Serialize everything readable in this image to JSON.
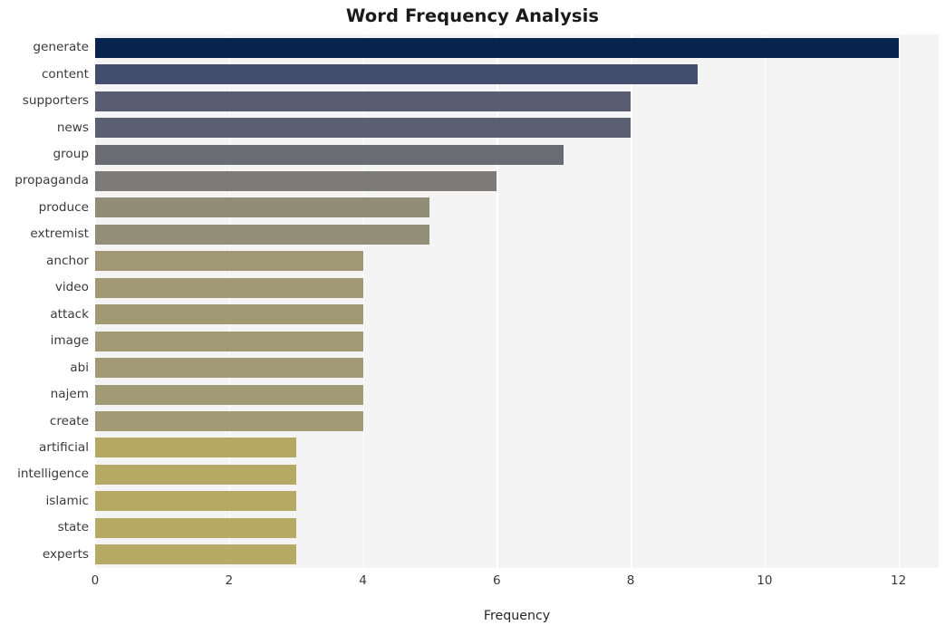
{
  "chart_data": {
    "type": "bar",
    "orientation": "horizontal",
    "title": "Word Frequency Analysis",
    "xlabel": "Frequency",
    "ylabel": "",
    "xlim": [
      0,
      12.6
    ],
    "ylim": [
      0,
      20
    ],
    "grid": true,
    "grid_axis": "x",
    "grid_color": "#ffffff",
    "plot_background": "#f4f4f5",
    "figure_background": "#ffffff",
    "legend": null,
    "xticks": [
      0,
      2,
      4,
      6,
      8,
      10,
      12
    ],
    "xticklabels": [
      "0",
      "2",
      "4",
      "6",
      "8",
      "10",
      "12"
    ],
    "categories": [
      "generate",
      "content",
      "supporters",
      "news",
      "group",
      "propaganda",
      "produce",
      "extremist",
      "anchor",
      "video",
      "attack",
      "image",
      "abi",
      "najem",
      "create",
      "artificial",
      "intelligence",
      "islamic",
      "state",
      "experts"
    ],
    "values": [
      12,
      9,
      8,
      8,
      7,
      6,
      5,
      5,
      4,
      4,
      4,
      4,
      4,
      4,
      4,
      3,
      3,
      3,
      3,
      3
    ],
    "bar_colors": [
      "#06244d",
      "#434d6d",
      "#595d71",
      "#5b5f72",
      "#6a6b73",
      "#7c7b77",
      "#918d77",
      "#928e78",
      "#a09874",
      "#a19974",
      "#a19974",
      "#a29a75",
      "#a29a75",
      "#a39b75",
      "#a39b75",
      "#b5a863",
      "#b6a963",
      "#b6a963",
      "#b7aa64",
      "#b7aa64"
    ]
  }
}
